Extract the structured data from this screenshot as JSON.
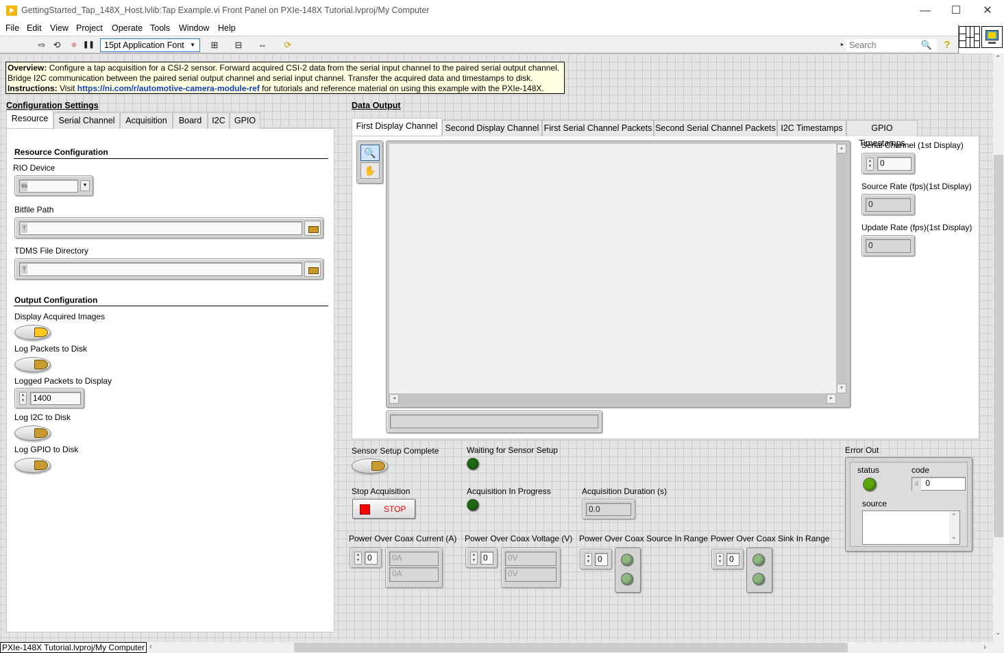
{
  "window": {
    "title": "GettingStarted_Tap_148X_Host.lvlib:Tap Example.vi Front Panel on PXIe-148X Tutorial.lvproj/My Computer",
    "minimize": "—",
    "maximize": "☐",
    "close": "✕"
  },
  "menu": [
    "File",
    "Edit",
    "View",
    "Project",
    "Operate",
    "Tools",
    "Window",
    "Help"
  ],
  "toolbar": {
    "run_icon": "⇨",
    "run_continuous_icon": "⟲",
    "abort_icon": "●",
    "pause_icon": "❚❚",
    "font_select": "15pt Application Font",
    "align_icon": "⊞",
    "distribute_icon": "⊟",
    "resize_icon": "⇔",
    "reorder_icon": "⟳",
    "search_placeholder": "Search",
    "search_icon": "🔍",
    "help_icon": "?"
  },
  "overview": {
    "overview_label": "Overview:",
    "overview_text_1": " Configure a tap acquisition for a CSI-2 sensor. Forward acquired CSI-2 data from the serial input channel to the paired serial output channel.",
    "overview_text_2": "Bridge I2C communication between the paired serial output channel and serial input channel. Transfer the acquired data and timestamps to disk.",
    "instructions_label": "Instructions:",
    "instructions_pre": " Visit ",
    "instructions_link": "https://ni.com/r/automotive-camera-module-ref",
    "instructions_post": " for tutorials and reference material on using this example with the PXIe-148X."
  },
  "config": {
    "title": "Configuration Settings",
    "tabs": [
      "Resource",
      "Serial Channel",
      "Acquisition",
      "Board",
      "I2C",
      "GPIO"
    ],
    "active_tab": "Resource",
    "resource_header": "Resource Configuration",
    "rio_device_label": "RIO Device",
    "rio_device_value": "",
    "bitfile_label": "Bitfile Path",
    "bitfile_value": "",
    "tdms_label": "TDMS File Directory",
    "tdms_value": "",
    "output_header": "Output Configuration",
    "display_images_label": "Display Acquired Images",
    "display_images_on": true,
    "log_packets_label": "Log Packets to Disk",
    "log_packets_on": false,
    "logged_packets_label": "Logged Packets to Display",
    "logged_packets_value": "1400",
    "log_i2c_label": "Log I2C to Disk",
    "log_i2c_on": false,
    "log_gpio_label": "Log GPIO to Disk",
    "log_gpio_on": false
  },
  "output": {
    "title": "Data Output",
    "tabs": [
      "First Display Channel",
      "Second Display Channel",
      "First Serial Channel Packets",
      "Second Serial Channel Packets",
      "I2C Timestamps",
      "GPIO Timestamps"
    ],
    "active_tab": "First Display Channel",
    "serial_channel_label": "Serial Channel (1st Display)",
    "serial_channel_value": "0",
    "source_rate_label": "Source Rate (fps)(1st Display)",
    "source_rate_value": "0",
    "update_rate_label": "Update Rate (fps)(1st Display)",
    "update_rate_value": "0",
    "image_info_value": ""
  },
  "status": {
    "sensor_setup_label": "Sensor Setup Complete",
    "waiting_label": "Waiting for Sensor Setup",
    "stop_label": "Stop Acquisition",
    "stop_button": "STOP",
    "in_progress_label": "Acquisition In Progress",
    "duration_label": "Acquisition Duration (s)",
    "duration_value": "0.0",
    "poc_current_label": "Power Over Coax Current (A)",
    "poc_current_index": "0",
    "poc_current_values": [
      "0A",
      "0A"
    ],
    "poc_voltage_label": "Power Over Coax Voltage (V)",
    "poc_voltage_index": "0",
    "poc_voltage_values": [
      "0V",
      "0V"
    ],
    "poc_source_label": "Power Over Coax Source In Range",
    "poc_source_index": "0",
    "poc_sink_label": "Power Over Coax Sink In Range",
    "poc_sink_index": "0"
  },
  "error_out": {
    "label": "Error Out",
    "status_label": "status",
    "code_label": "code",
    "code_radix": "d",
    "code_value": "0",
    "source_label": "source",
    "source_value": ""
  },
  "statusbar": {
    "context": "PXIe-148X Tutorial.lvproj/My Computer"
  }
}
